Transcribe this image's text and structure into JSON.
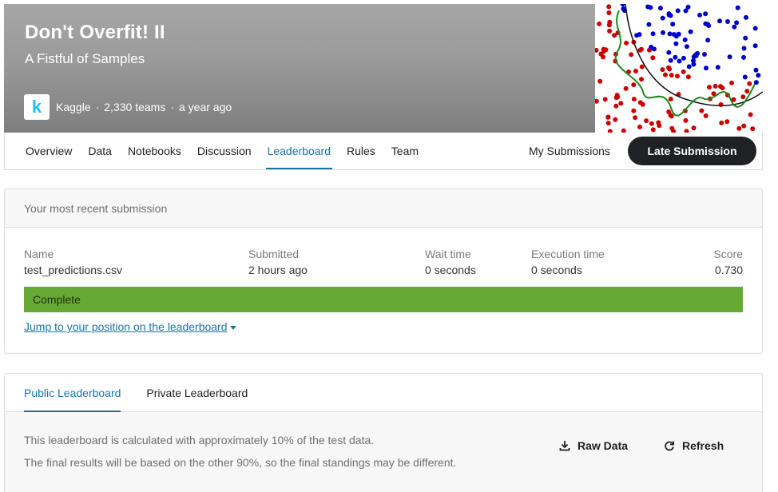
{
  "competition": {
    "title": "Don't Overfit! II",
    "subtitle": "A Fistful of Samples",
    "host": "Kaggle",
    "teams": "2,330 teams",
    "age": "a year ago",
    "logo_letter": "k"
  },
  "nav": {
    "tabs": [
      "Overview",
      "Data",
      "Notebooks",
      "Discussion",
      "Leaderboard",
      "Rules",
      "Team"
    ],
    "active_tab": "Leaderboard",
    "my_submissions": "My Submissions",
    "late_submission": "Late Submission"
  },
  "submission": {
    "header": "Your most recent submission",
    "columns": {
      "name_label": "Name",
      "name_value": "test_predictions.csv",
      "submitted_label": "Submitted",
      "submitted_value": "2 hours ago",
      "wait_label": "Wait time",
      "wait_value": "0 seconds",
      "exec_label": "Execution time",
      "exec_value": "0 seconds",
      "score_label": "Score",
      "score_value": "0.730"
    },
    "status": "Complete",
    "status_color": "#66aa35",
    "jump_link": "Jump to your position on the leaderboard"
  },
  "leaderboard": {
    "tabs": [
      "Public Leaderboard",
      "Private Leaderboard"
    ],
    "active_tab": "Public Leaderboard",
    "note_line1": "This leaderboard is calculated with approximately 10% of the test data.",
    "note_line2": "The final results will be based on the other 90%, so the final standings may be different.",
    "raw_data": "Raw Data",
    "refresh": "Refresh"
  },
  "colors": {
    "accent": "#1a73a8",
    "dark_button": "#202124",
    "banner": "#9a9a9a",
    "dots_red": "#cc0000",
    "dots_blue": "#0000cc",
    "curve_green": "#1a8a1a"
  }
}
